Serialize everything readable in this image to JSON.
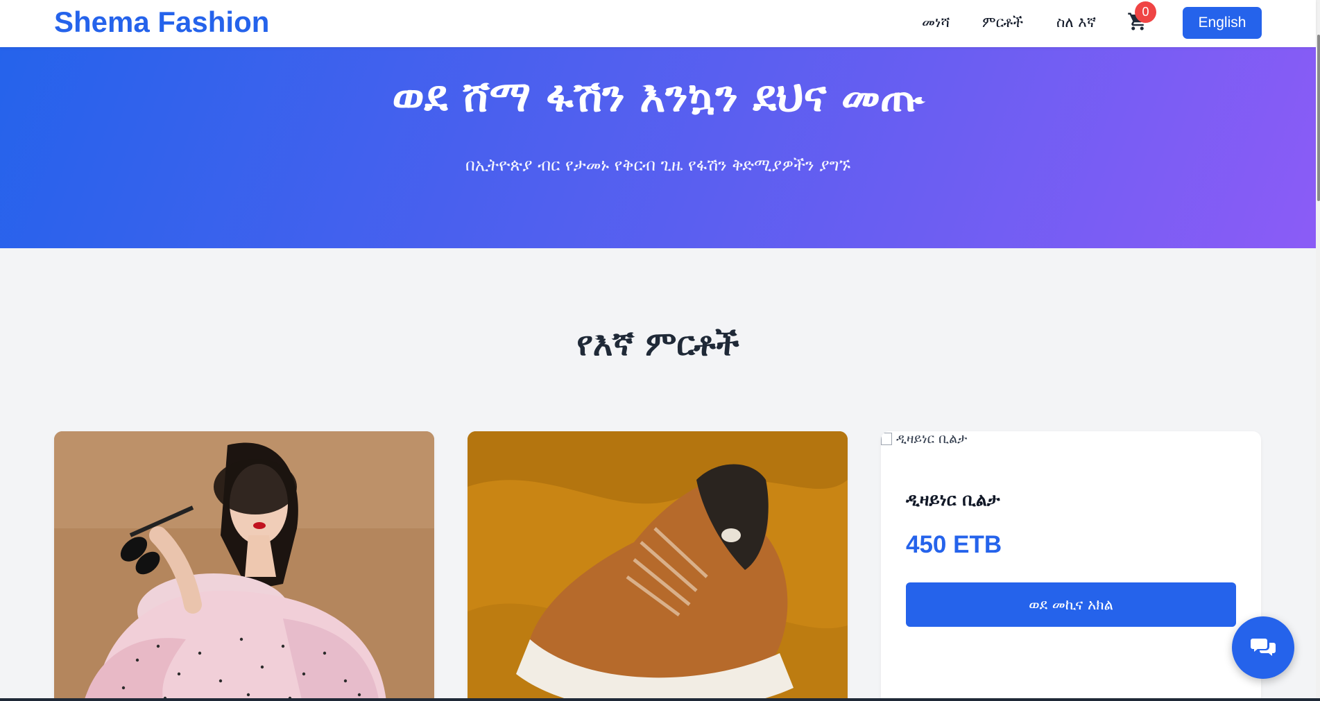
{
  "header": {
    "brand": "Shema Fashion",
    "nav": [
      "መነሻ",
      "ምርቶች",
      "ስለ እኛ"
    ],
    "cart_count": "0",
    "language_button": "English",
    "cart_icon": "shopping-cart-icon"
  },
  "hero": {
    "title": "ወደ ሸማ ፋሽን እንኳን ደህና መጡ",
    "subtitle": "በኢትዮጵያ ብር የታመኑ የቅርብ ጊዜ የፋሽን ቅድሚያዎችን ያግኙ"
  },
  "products_section": {
    "title": "የእኛ ምርቶች",
    "products": [
      {
        "image_alt": "",
        "description": "woman in pink polka-dot ruffled dress holding sunglasses"
      },
      {
        "image_alt": "",
        "description": "brown sneaker on mustard fabric"
      },
      {
        "image_alt": "ዲዛይነር ቢልታ",
        "name": "ዲዛይነር ቢልታ",
        "price": "450 ETB",
        "button": "ወደ መኪና አክል"
      }
    ]
  },
  "chat_button": {
    "icon": "chat-bubbles-icon"
  },
  "colors": {
    "primary": "#2563eb",
    "badge": "#ef4444",
    "hero_gradient_start": "#2563eb",
    "hero_gradient_end": "#8b5cf6",
    "background": "#f3f4f6"
  }
}
